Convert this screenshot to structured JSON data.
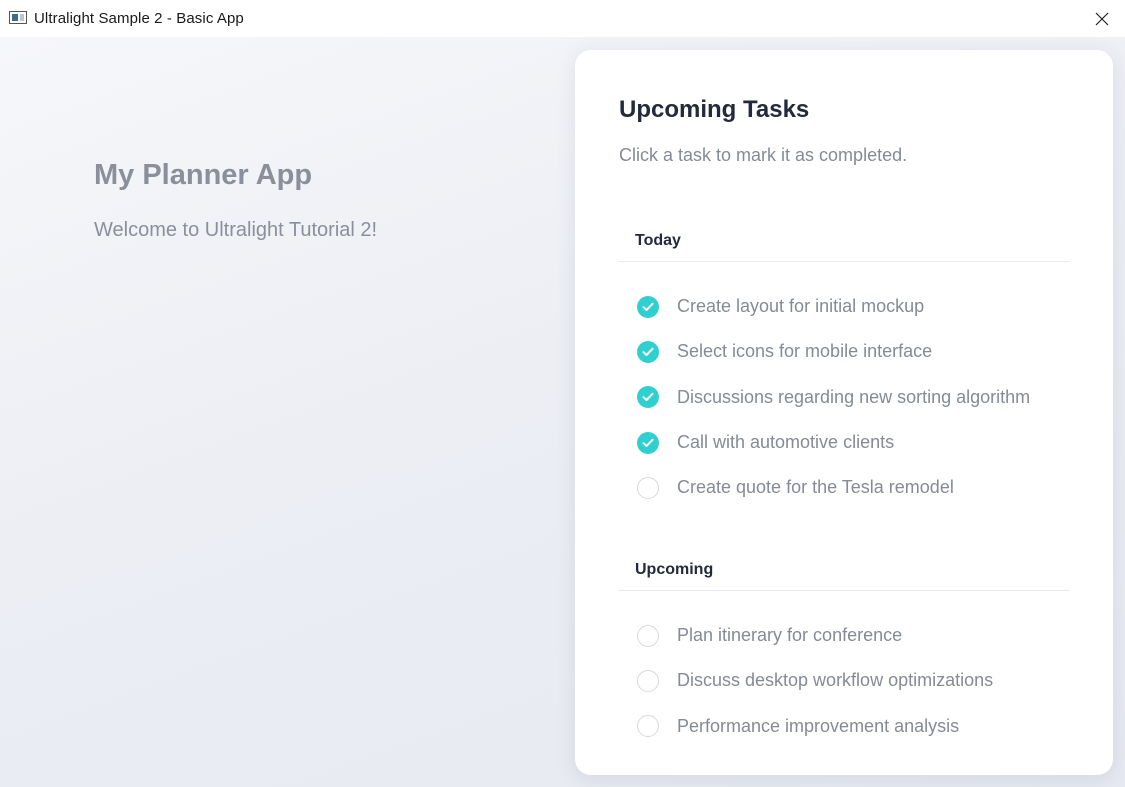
{
  "window": {
    "title": "Ultralight Sample 2 - Basic App"
  },
  "welcome": {
    "title": "My Planner App",
    "subtitle": "Welcome to Ultralight Tutorial 2!"
  },
  "tasks_card": {
    "title": "Upcoming Tasks",
    "subtitle": "Click a task to mark it as completed.",
    "sections": [
      {
        "name": "Today",
        "items": [
          {
            "label": "Create layout for initial mockup",
            "completed": true
          },
          {
            "label": "Select icons for mobile interface",
            "completed": true
          },
          {
            "label": "Discussions regarding new sorting algorithm",
            "completed": true
          },
          {
            "label": "Call with automotive clients",
            "completed": true
          },
          {
            "label": "Create quote for the Tesla remodel",
            "completed": false
          }
        ]
      },
      {
        "name": "Upcoming",
        "items": [
          {
            "label": "Plan itinerary for conference",
            "completed": false
          },
          {
            "label": "Discuss desktop workflow optimizations",
            "completed": false
          },
          {
            "label": "Performance improvement analysis",
            "completed": false
          }
        ]
      }
    ]
  },
  "colors": {
    "accent": "#2fd0cf",
    "heading": "#232a3b",
    "muted": "#858a96"
  },
  "icons": {
    "close": "close-icon",
    "check": "check-icon"
  }
}
